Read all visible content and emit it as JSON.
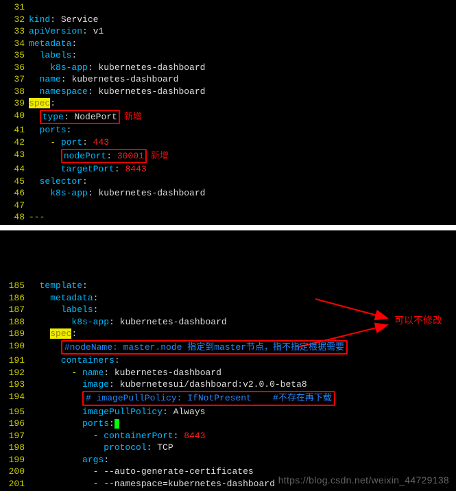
{
  "block1": {
    "start": 31,
    "lines": [
      [
        {
          "c": "",
          "t": ""
        }
      ],
      [
        {
          "c": "kw",
          "t": "kind"
        },
        {
          "c": "",
          "t": ": "
        },
        {
          "c": "val",
          "t": "Service"
        }
      ],
      [
        {
          "c": "kw",
          "t": "apiVersion"
        },
        {
          "c": "",
          "t": ": "
        },
        {
          "c": "val",
          "t": "v1"
        }
      ],
      [
        {
          "c": "kw",
          "t": "metadata"
        },
        {
          "c": "",
          "t": ":"
        }
      ],
      [
        {
          "c": "",
          "t": "  "
        },
        {
          "c": "kw",
          "t": "labels"
        },
        {
          "c": "",
          "t": ":"
        }
      ],
      [
        {
          "c": "",
          "t": "    "
        },
        {
          "c": "kw",
          "t": "k8s-app"
        },
        {
          "c": "",
          "t": ": "
        },
        {
          "c": "val",
          "t": "kubernetes-dashboard"
        }
      ],
      [
        {
          "c": "",
          "t": "  "
        },
        {
          "c": "kw",
          "t": "name"
        },
        {
          "c": "",
          "t": ": "
        },
        {
          "c": "val",
          "t": "kubernetes-dashboard"
        }
      ],
      [
        {
          "c": "",
          "t": "  "
        },
        {
          "c": "kw",
          "t": "namespace"
        },
        {
          "c": "",
          "t": ": "
        },
        {
          "c": "val",
          "t": "kubernetes-dashboard"
        }
      ],
      [
        {
          "c": "spec-hl",
          "t": "spec"
        },
        {
          "c": "",
          "t": ":"
        }
      ],
      [
        {
          "c": "",
          "t": "  "
        },
        {
          "c": "box",
          "inner": [
            {
              "c": "kw",
              "t": "type"
            },
            {
              "c": "",
              "t": ": "
            },
            {
              "c": "val",
              "t": "NodePort"
            }
          ]
        },
        {
          "c": "annot",
          "t": "新增"
        }
      ],
      [
        {
          "c": "",
          "t": "  "
        },
        {
          "c": "kw",
          "t": "ports"
        },
        {
          "c": "",
          "t": ":"
        }
      ],
      [
        {
          "c": "",
          "t": "    "
        },
        {
          "c": "dash",
          "t": "-"
        },
        {
          "c": "",
          "t": " "
        },
        {
          "c": "kw",
          "t": "port"
        },
        {
          "c": "",
          "t": ": "
        },
        {
          "c": "num",
          "t": "443"
        }
      ],
      [
        {
          "c": "",
          "t": "      "
        },
        {
          "c": "box",
          "inner": [
            {
              "c": "kw",
              "t": "nodePort"
            },
            {
              "c": "",
              "t": ": "
            },
            {
              "c": "num",
              "t": "30001"
            }
          ]
        },
        {
          "c": "annot",
          "t": "新增"
        }
      ],
      [
        {
          "c": "",
          "t": "      "
        },
        {
          "c": "kw",
          "t": "targetPort"
        },
        {
          "c": "",
          "t": ": "
        },
        {
          "c": "num",
          "t": "8443"
        }
      ],
      [
        {
          "c": "",
          "t": "  "
        },
        {
          "c": "kw",
          "t": "selector"
        },
        {
          "c": "",
          "t": ":"
        }
      ],
      [
        {
          "c": "",
          "t": "    "
        },
        {
          "c": "kw",
          "t": "k8s-app"
        },
        {
          "c": "",
          "t": ": "
        },
        {
          "c": "val",
          "t": "kubernetes-dashboard"
        }
      ],
      [
        {
          "c": "",
          "t": ""
        }
      ],
      [
        {
          "c": "comment-ellipsis",
          "t": "---"
        }
      ]
    ]
  },
  "block2": {
    "start": 185,
    "lines": [
      [
        {
          "c": "",
          "t": "  "
        },
        {
          "c": "kw",
          "t": "template"
        },
        {
          "c": "",
          "t": ":"
        }
      ],
      [
        {
          "c": "",
          "t": "    "
        },
        {
          "c": "kw",
          "t": "metadata"
        },
        {
          "c": "",
          "t": ":"
        }
      ],
      [
        {
          "c": "",
          "t": "      "
        },
        {
          "c": "kw",
          "t": "labels"
        },
        {
          "c": "",
          "t": ":"
        }
      ],
      [
        {
          "c": "",
          "t": "        "
        },
        {
          "c": "kw",
          "t": "k8s-app"
        },
        {
          "c": "",
          "t": ": "
        },
        {
          "c": "val",
          "t": "kubernetes-dashboard"
        }
      ],
      [
        {
          "c": "",
          "t": "    "
        },
        {
          "c": "spec-hl",
          "t": "spec"
        },
        {
          "c": "",
          "t": ":"
        }
      ],
      [
        {
          "c": "",
          "t": "      "
        },
        {
          "c": "linebox",
          "inner": [
            {
              "c": "comment-blue",
              "t": "#nodeName: master.node 指定到master节点，指不指定根据需要"
            }
          ]
        }
      ],
      [
        {
          "c": "",
          "t": "      "
        },
        {
          "c": "kw",
          "t": "containers"
        },
        {
          "c": "",
          "t": ":"
        }
      ],
      [
        {
          "c": "",
          "t": "        "
        },
        {
          "c": "dash",
          "t": "-"
        },
        {
          "c": "",
          "t": " "
        },
        {
          "c": "kw",
          "t": "name"
        },
        {
          "c": "",
          "t": ": "
        },
        {
          "c": "val",
          "t": "kubernetes-dashboard"
        }
      ],
      [
        {
          "c": "",
          "t": "          "
        },
        {
          "c": "kw",
          "t": "image"
        },
        {
          "c": "",
          "t": ": "
        },
        {
          "c": "val",
          "t": "kubernetesui/dashboard:v2.0.0-beta8"
        }
      ],
      [
        {
          "c": "",
          "t": "          "
        },
        {
          "c": "linebox",
          "inner": [
            {
              "c": "comment-blue",
              "t": "# imagePullPolicy: IfNotPresent    #不存在再下载"
            }
          ]
        }
      ],
      [
        {
          "c": "",
          "t": "          "
        },
        {
          "c": "kw",
          "t": "imagePullPolicy"
        },
        {
          "c": "",
          "t": ": "
        },
        {
          "c": "val",
          "t": "Always"
        }
      ],
      [
        {
          "c": "",
          "t": "          "
        },
        {
          "c": "kw",
          "t": "ports"
        },
        {
          "c": "",
          "t": ":"
        },
        {
          "c": "cursor",
          "t": ""
        }
      ],
      [
        {
          "c": "",
          "t": "            "
        },
        {
          "c": "dash",
          "t": "-"
        },
        {
          "c": "",
          "t": " "
        },
        {
          "c": "kw",
          "t": "containerPort"
        },
        {
          "c": "",
          "t": ": "
        },
        {
          "c": "num",
          "t": "8443"
        }
      ],
      [
        {
          "c": "",
          "t": "              "
        },
        {
          "c": "kw",
          "t": "protocol"
        },
        {
          "c": "",
          "t": ": "
        },
        {
          "c": "val",
          "t": "TCP"
        }
      ],
      [
        {
          "c": "",
          "t": "          "
        },
        {
          "c": "kw",
          "t": "args"
        },
        {
          "c": "",
          "t": ":"
        }
      ],
      [
        {
          "c": "",
          "t": "            "
        },
        {
          "c": "dash",
          "t": "-"
        },
        {
          "c": "",
          "t": " "
        },
        {
          "c": "val",
          "t": "--auto-generate-certificates"
        }
      ],
      [
        {
          "c": "",
          "t": "            "
        },
        {
          "c": "dash",
          "t": "-"
        },
        {
          "c": "",
          "t": " "
        },
        {
          "c": "val",
          "t": "--namespace=kubernetes-dashboard"
        }
      ]
    ],
    "side_label": "可以不修改"
  },
  "watermark": "https://blog.csdn.net/weixin_44729138"
}
